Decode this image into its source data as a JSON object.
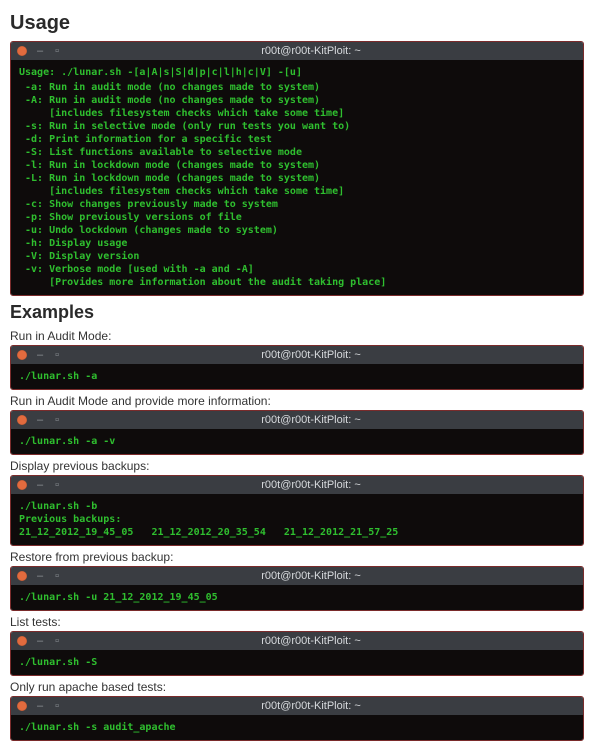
{
  "headings": {
    "usage": "Usage",
    "examples": "Examples"
  },
  "titlebar": "r00t@r00t-KitPloit: ~",
  "usage_block": {
    "header": "Usage: ./lunar.sh -[a|A|s|S|d|p|c|l|h|c|V] -[u]",
    "lines": [
      " -a: Run in audit mode (no changes made to system)",
      " -A: Run in audit mode (no changes made to system)",
      "     [includes filesystem checks which take some time]",
      " -s: Run in selective mode (only run tests you want to)",
      " -d: Print information for a specific test",
      " -S: List functions available to selective mode",
      " -l: Run in lockdown mode (changes made to system)",
      " -L: Run in lockdown mode (changes made to system)",
      "     [includes filesystem checks which take some time]",
      " -c: Show changes previously made to system",
      " -p: Show previously versions of file",
      " -u: Undo lockdown (changes made to system)",
      " -h: Display usage",
      " -V: Display version",
      " -v: Verbose mode [used with -a and -A]",
      "     [Provides more information about the audit taking place]"
    ]
  },
  "examples": [
    {
      "desc": "Run in Audit Mode:",
      "body": "./lunar.sh -a"
    },
    {
      "desc": "Run in Audit Mode and provide more information:",
      "body": "./lunar.sh -a -v"
    },
    {
      "desc": "Display previous backups:",
      "body": "./lunar.sh -b\nPrevious backups:\n21_12_2012_19_45_05   21_12_2012_20_35_54   21_12_2012_21_57_25"
    },
    {
      "desc": "Restore from previous backup:",
      "body": "./lunar.sh -u 21_12_2012_19_45_05"
    },
    {
      "desc": "List tests:",
      "body": "./lunar.sh -S"
    },
    {
      "desc": "Only run apache based tests:",
      "body": "./lunar.sh -s audit_apache"
    }
  ]
}
